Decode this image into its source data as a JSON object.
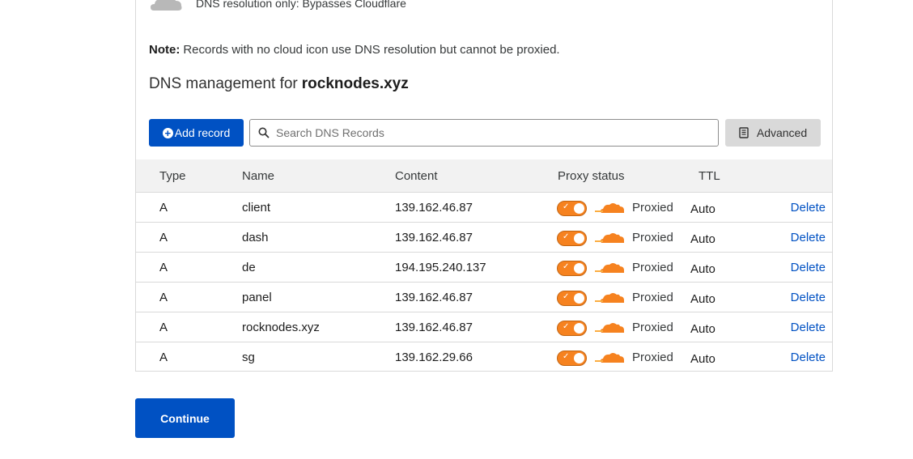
{
  "legend": {
    "icon": "cloud-grey-icon",
    "text": "DNS resolution only: Bypasses Cloudflare"
  },
  "note": {
    "label": "Note:",
    "text": "Records with no cloud icon use DNS resolution but cannot be proxied."
  },
  "management": {
    "prefix": "DNS management for",
    "domain": "rocknodes.xyz"
  },
  "toolbar": {
    "add_label": "Add record",
    "search_placeholder": "Search DNS Records",
    "search_value": "",
    "advanced_label": "Advanced"
  },
  "table": {
    "headers": {
      "type": "Type",
      "name": "Name",
      "content": "Content",
      "proxy": "Proxy status",
      "ttl": "TTL"
    },
    "rows": [
      {
        "type": "A",
        "name": "client",
        "content": "139.162.46.87",
        "proxy": "Proxied",
        "ttl": "Auto",
        "action": "Delete"
      },
      {
        "type": "A",
        "name": "dash",
        "content": "139.162.46.87",
        "proxy": "Proxied",
        "ttl": "Auto",
        "action": "Delete"
      },
      {
        "type": "A",
        "name": "de",
        "content": "194.195.240.137",
        "proxy": "Proxied",
        "ttl": "Auto",
        "action": "Delete"
      },
      {
        "type": "A",
        "name": "panel",
        "content": "139.162.46.87",
        "proxy": "Proxied",
        "ttl": "Auto",
        "action": "Delete"
      },
      {
        "type": "A",
        "name": "rocknodes.xyz",
        "content": "139.162.46.87",
        "proxy": "Proxied",
        "ttl": "Auto",
        "action": "Delete"
      },
      {
        "type": "A",
        "name": "sg",
        "content": "139.162.29.66",
        "proxy": "Proxied",
        "ttl": "Auto",
        "action": "Delete"
      }
    ]
  },
  "continue_label": "Continue",
  "colors": {
    "accent": "#0051c3",
    "proxy_orange": "#f6821f",
    "cloud_grey": "#b8b8b8"
  }
}
